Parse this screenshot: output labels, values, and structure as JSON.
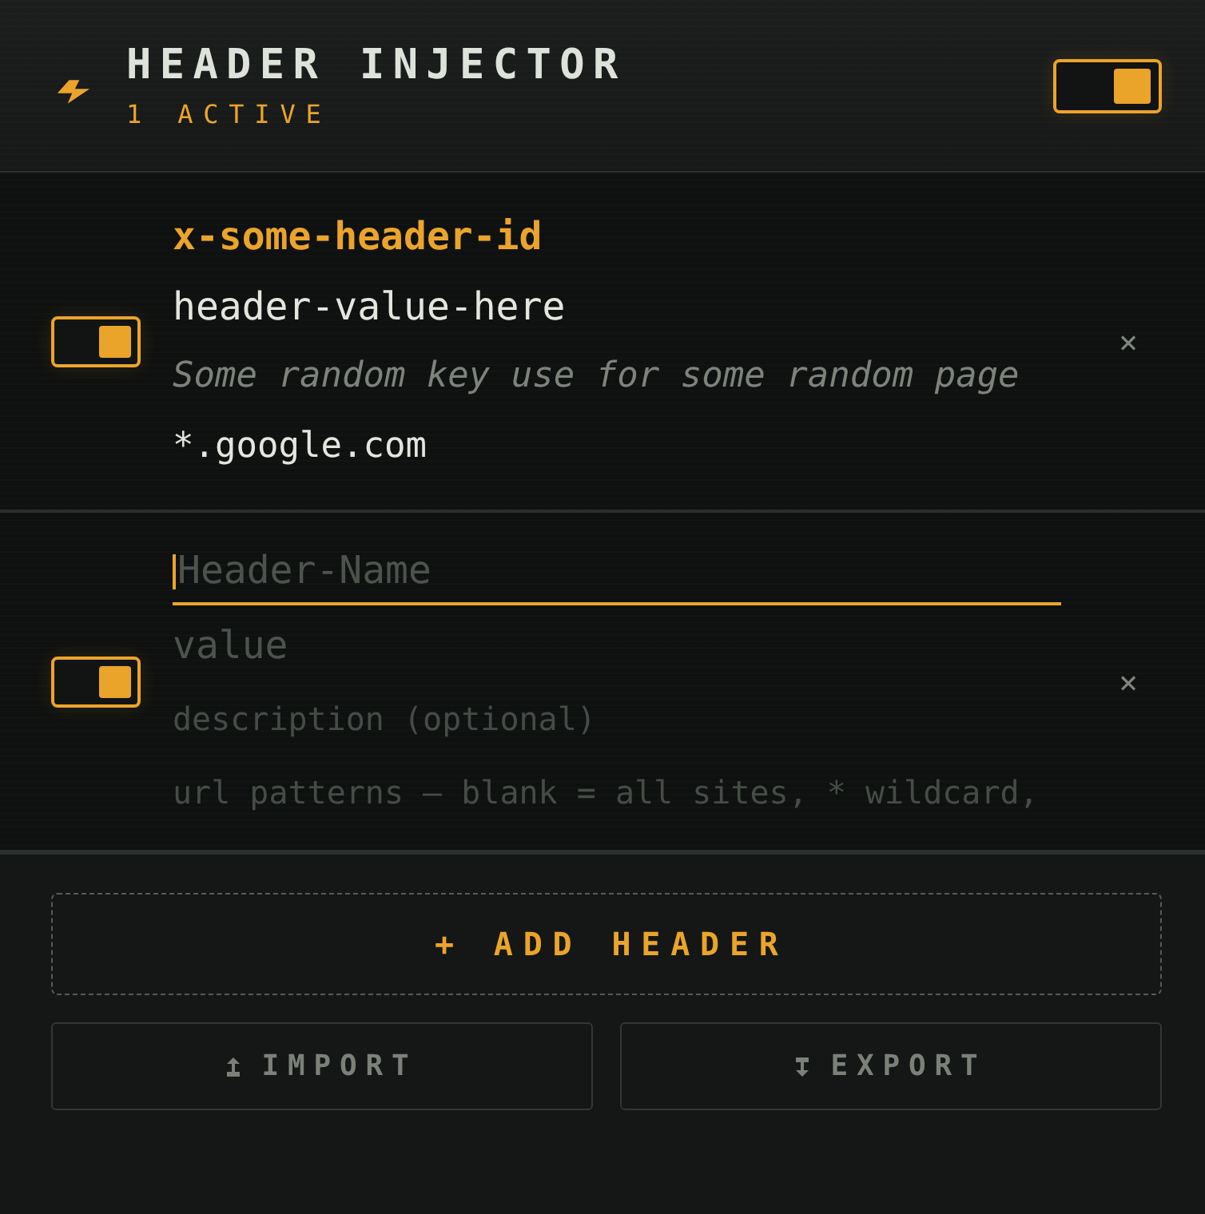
{
  "header": {
    "title": "HEADER INJECTOR",
    "subtitle": "1 ACTIVE",
    "enabled": true
  },
  "rows": [
    {
      "kind": "saved",
      "enabled": true,
      "name": "x-some-header-id",
      "value": "header-value-here",
      "description": "Some random key use for some random page",
      "patterns": "*.google.com",
      "remove": "×"
    },
    {
      "kind": "draft",
      "enabled": true,
      "fields": [
        {
          "kind": "name",
          "placeholder": "Header-Name",
          "focused": true
        },
        {
          "kind": "value",
          "placeholder": "value",
          "focused": false
        },
        {
          "kind": "description",
          "placeholder": "description (optional)",
          "focused": false
        },
        {
          "kind": "patterns",
          "placeholder": "url patterns — blank = all sites, * wildcard,",
          "focused": false
        }
      ],
      "remove": "×"
    }
  ],
  "actions": {
    "add": "+ ADD HEADER",
    "import": "IMPORT",
    "export": "EXPORT"
  }
}
